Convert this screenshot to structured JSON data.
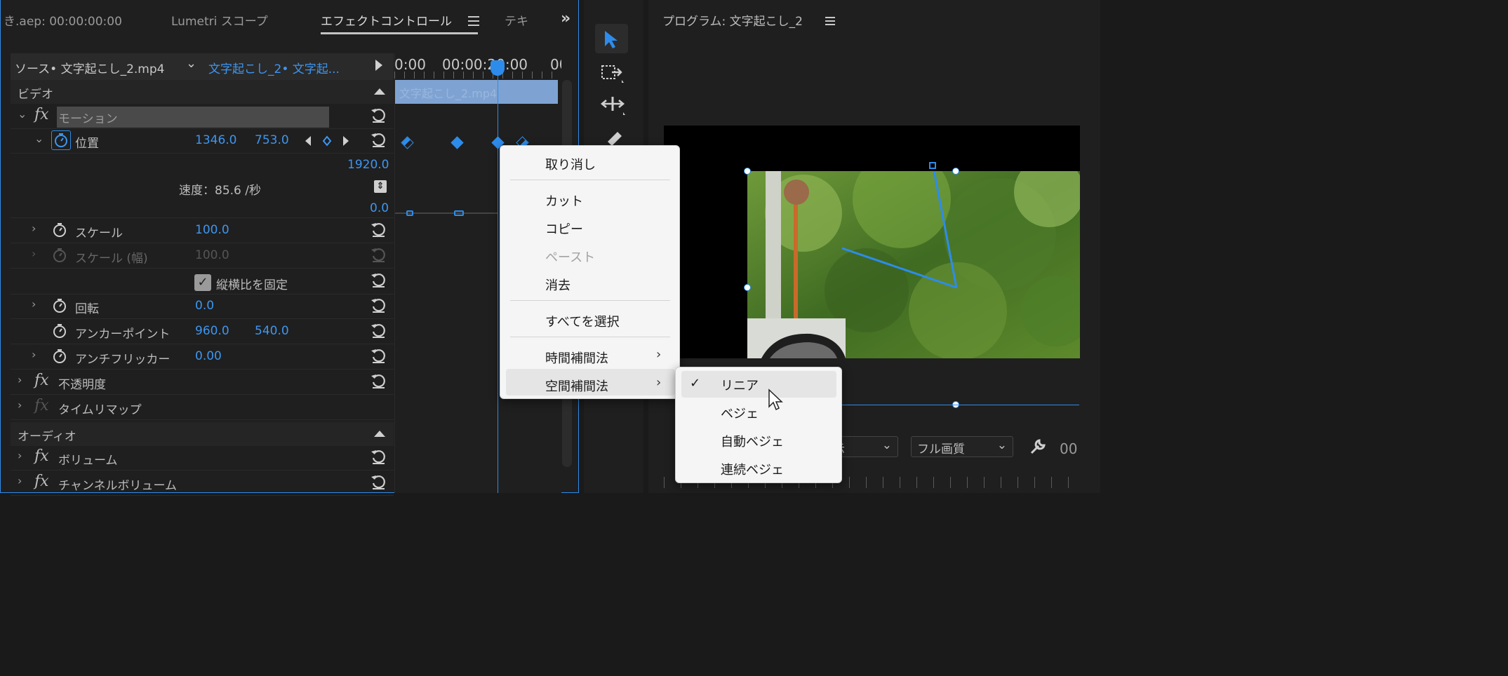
{
  "tabs": {
    "project": "き.aep: 00:00:00:00",
    "lumetri": "Lumetri スコープ",
    "effect_controls": "エフェクトコントロール",
    "text": "テキ"
  },
  "source": {
    "source_label": "ソース• 文字起こし_2.mp4",
    "sequence_label": "文字起こし_2• 文字起..."
  },
  "timeline": {
    "tc_left": "0:00",
    "tc_right": "00:00:20:00",
    "tc_end": "00",
    "clip_name": "文字起こし_2.mp4"
  },
  "sections": {
    "video": "ビデオ",
    "audio": "オーディオ"
  },
  "motion": {
    "label": "モーション",
    "position_label": "位置",
    "position_x": "1346.0",
    "position_y": "753.0",
    "speed_top": "1920.0",
    "speed_text": "速度：85.6 /秒",
    "speed_bottom": "0.0",
    "scale_label": "スケール",
    "scale_value": "100.0",
    "scale_width_label": "スケール (幅)",
    "scale_width_value": "100.0",
    "uniform_label": "縦横比を固定",
    "uniform_checked": true,
    "rotation_label": "回転",
    "rotation_value": "0.0",
    "anchor_label": "アンカーポイント",
    "anchor_x": "960.0",
    "anchor_y": "540.0",
    "flicker_label": "アンチフリッカー",
    "flicker_value": "0.00"
  },
  "effects": {
    "opacity": "不透明度",
    "time_remap": "タイムリマップ",
    "volume": "ボリューム",
    "channel_volume": "チャンネルボリューム"
  },
  "program": {
    "title": "プログラム: 文字起こし_2",
    "view_select": "示",
    "quality_select": "フル画質",
    "timecode_frag": "00"
  },
  "context_menu": {
    "undo": "取り消し",
    "cut": "カット",
    "copy": "コピー",
    "paste": "ペースト",
    "clear": "消去",
    "select_all": "すべてを選択",
    "temporal": "時間補間法",
    "spatial": "空間補間法"
  },
  "submenu": {
    "linear": "リニア",
    "bezier": "ベジェ",
    "auto_bezier": "自動ベジェ",
    "continuous_bezier": "連続ベジェ",
    "selected": "リニア"
  },
  "colors": {
    "accent": "#2d8ceb",
    "panel_bg": "#1f1f1f",
    "menu_bg": "#f5f5f5"
  }
}
